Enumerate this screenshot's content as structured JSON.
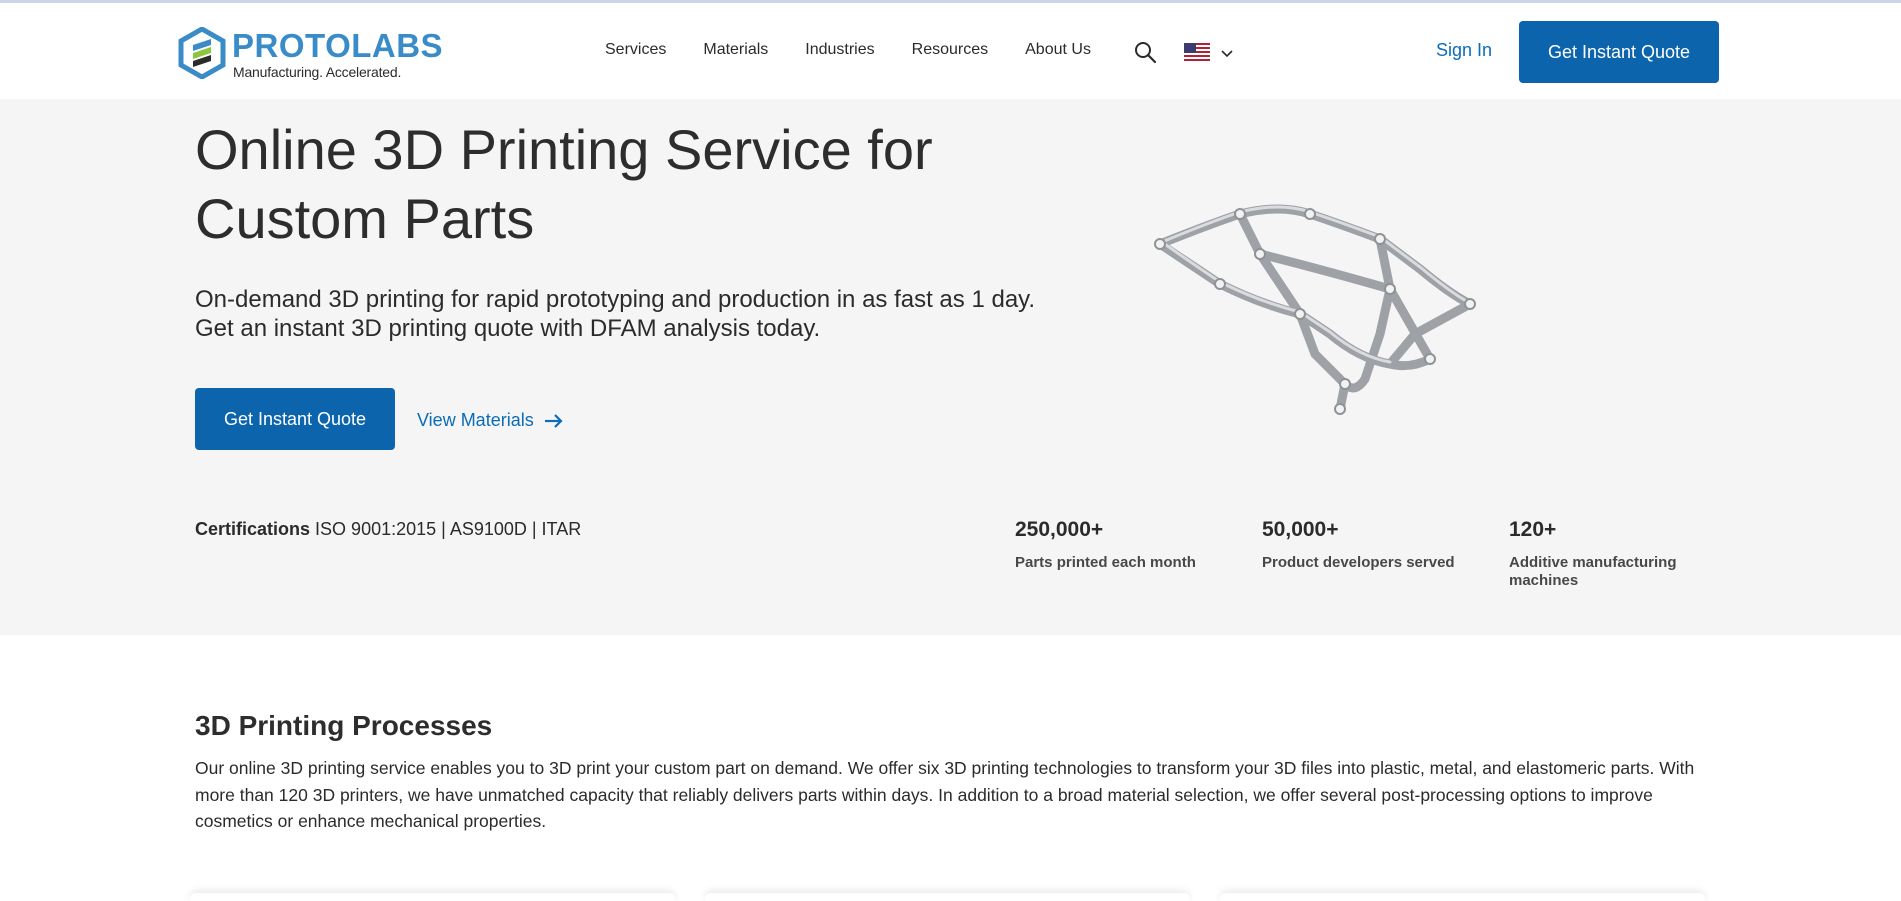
{
  "header": {
    "logo_word": "PROTOLABS",
    "logo_tagline": "Manufacturing. Accelerated.",
    "nav": [
      {
        "label": "Services"
      },
      {
        "label": "Materials"
      },
      {
        "label": "Industries"
      },
      {
        "label": "Resources"
      },
      {
        "label": "About Us"
      }
    ],
    "search_icon": "search-icon",
    "locale_icon": "us-flag-icon",
    "sign_in": "Sign In",
    "cta": "Get Instant Quote"
  },
  "hero": {
    "title": "Online 3D Printing Service for Custom Parts",
    "subtitle": "On-demand 3D printing for rapid prototyping and production in as fast as 1 day. Get an instant 3D printing quote with DFAM analysis today.",
    "cta": "Get Instant Quote",
    "secondary_link": "View Materials",
    "certifications_label": "Certifications",
    "certifications_value": "ISO 9001:2015 | AS9100D | ITAR",
    "stats": [
      {
        "value": "250,000+",
        "label": "Parts printed each month"
      },
      {
        "value": "50,000+",
        "label": "Product developers served"
      },
      {
        "value": "120+",
        "label": "Additive manufacturing machines"
      }
    ]
  },
  "processes": {
    "title": "3D Printing Processes",
    "body": "Our online 3D printing service enables you to 3D print your custom part on demand. We offer six 3D printing technologies to transform your 3D files into plastic, metal, and elastomeric parts. With more than 120 3D printers, we have unmatched capacity that reliably delivers parts within days. In addition to a broad material selection, we offer several post-processing options to improve cosmetics or enhance mechanical properties."
  },
  "colors": {
    "brand_blue": "#0b64ac",
    "link_blue": "#0b6cb7",
    "logo_blue": "#3a8cc8",
    "hero_bg": "#f5f5f5"
  }
}
